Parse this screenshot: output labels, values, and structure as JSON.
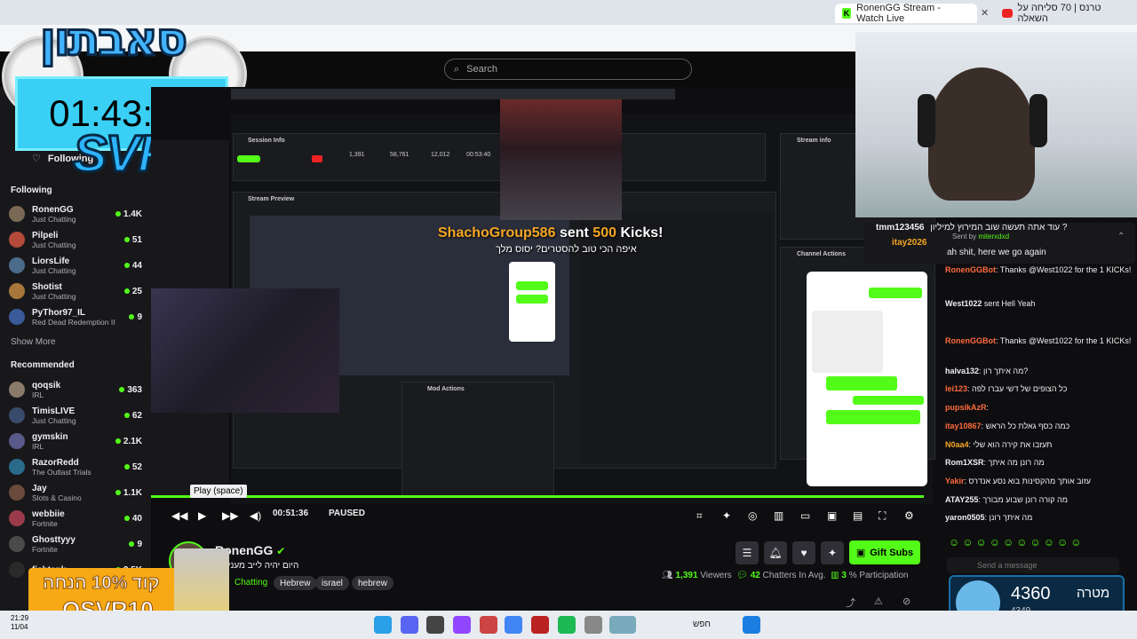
{
  "browser": {
    "tabs": [
      {
        "label": "RonenGG Stream - Watch Live"
      },
      {
        "label": "טרנס | 70 סליחה על השאלה"
      }
    ]
  },
  "header": {
    "search_placeholder": "Search"
  },
  "overlay": {
    "timer": "01:43:25",
    "svr": "SVR",
    "logo": "סאבתון"
  },
  "sidebar": {
    "following_title": "Following",
    "following_top": "Following",
    "following": [
      {
        "name": "RonenGG",
        "game": "Just Chatting",
        "viewers": "1.4K",
        "color": "#7a6a55"
      },
      {
        "name": "Pilpeli",
        "game": "Just Chatting",
        "viewers": "51",
        "color": "#b34a3a"
      },
      {
        "name": "LiorsLife",
        "game": "Just Chatting",
        "viewers": "44",
        "color": "#4b6b8a"
      },
      {
        "name": "Shotist",
        "game": "Just Chatting",
        "viewers": "25",
        "color": "#a8763a"
      },
      {
        "name": "PyThor97_IL",
        "game": "Red Dead Redemption II",
        "viewers": "9",
        "color": "#3a5a9a"
      }
    ],
    "show_more": "Show More",
    "recommended_title": "Recommended",
    "recommended": [
      {
        "name": "qoqsik",
        "game": "IRL",
        "viewers": "363",
        "color": "#8a7a6a"
      },
      {
        "name": "TimisLIVE",
        "game": "Just Chatting",
        "viewers": "62",
        "color": "#3a4a6a"
      },
      {
        "name": "gymskin",
        "game": "IRL",
        "viewers": "2.1K",
        "color": "#5a5a8a"
      },
      {
        "name": "RazorRedd",
        "game": "The Outlast Trials",
        "viewers": "52",
        "color": "#2a6a8a"
      },
      {
        "name": "Jay",
        "game": "Slots & Casino",
        "viewers": "1.1K",
        "color": "#6a4a3a"
      },
      {
        "name": "webbiie",
        "game": "Fortnite",
        "viewers": "40",
        "color": "#9a3a4a"
      },
      {
        "name": "Ghosttyyy",
        "game": "Fortnite",
        "viewers": "9",
        "color": "#4a4a4a"
      },
      {
        "name": "fishtank",
        "game": "",
        "viewers": "2.5K",
        "color": "#2a2a2a"
      }
    ]
  },
  "video": {
    "alert_user": "ShachoGroup586",
    "alert_sent": "sent",
    "alert_amount": "500",
    "alert_kicks": "Kicks!",
    "alert_sub": "איפה הכי טוב להסטרים? יסוס מלך",
    "tooltip": "Play (space)",
    "time": "00:51:36",
    "status": "PAUSED",
    "inner_labels": {
      "session_info": "Session Info",
      "stream_preview": "Stream Preview",
      "stream_info": "Stream info",
      "channel_actions": "Channel Actions",
      "mod_actions": "Mod Actions",
      "stats": [
        "STREAMING",
        "Partner Income",
        "OFF",
        "Multistream",
        "1,391",
        "Viewers",
        "58,761",
        "Followers",
        "12,012",
        "Sub Counts",
        "00:53:40",
        "Time Live"
      ]
    }
  },
  "stream": {
    "name": "RonenGG",
    "title": "היום יהיה לייב מעניין מ",
    "tags": [
      "Chatting",
      "Hebrew",
      "israel",
      "hebrew"
    ],
    "gift_subs": "Gift Subs",
    "viewers": "1,391",
    "viewers_label": "Viewers",
    "chatters": "42",
    "chatters_label": "Chatters In Avg.",
    "participation": "3",
    "participation_label": "% Participation"
  },
  "chat": {
    "pinned_top": "עוד אתה תעשה שוב המירוץ למיליון ?",
    "pinned_user": "tmm123456",
    "pinned_by": "Sent by",
    "pinned_by_user": "miterxdxd",
    "second_user": "itay2026",
    "pinned_msg": "ah shit, here we go again",
    "messages": [
      {
        "user": "RonenGGBot",
        "text": ": Thanks @West1022 for the 1 KICKs!",
        "color": "#ff6a3d"
      },
      {
        "user": "West1022",
        "text": " sent Hell Yeah",
        "color": "#efeff1"
      },
      {
        "user": "RonenGGBot",
        "text": ": Thanks @West1022 for the 1 KICKs!",
        "color": "#ff6a3d"
      },
      {
        "user": "halva132",
        "text": ": מה איתך רון?",
        "color": "#efeff1"
      },
      {
        "user": "lei123",
        "text": ": כל הצופים של דשי עברו לפה",
        "color": "#ff6a3d"
      },
      {
        "user": "pupsikAzR",
        "text": ":",
        "color": "#ff6a3d"
      },
      {
        "user": "itay10867",
        "text": ": כמה כסף גאלת כל הראש",
        "color": "#ff6a3d"
      },
      {
        "user": "N0aa4",
        "text": ": תעזבו את קירה הוא שלי",
        "color": "#f6a623"
      },
      {
        "user": "Rom1XSR",
        "text": ": מה רונן מה איתך",
        "color": "#efeff1"
      },
      {
        "user": "Yakir",
        "text": ": עזוב אותך מהקסינות בוא נסע אנדרס",
        "color": "#ff6a3d"
      },
      {
        "user": "ATAY255",
        "text": ": מה קורה רונן שבוע מבורך",
        "color": "#efeff1"
      },
      {
        "user": "yaron0505",
        "text": ": מה איתך רונן",
        "color": "#efeff1"
      }
    ],
    "input_placeholder": "Send a message",
    "goal_value": "4360",
    "goal_label": "מטרה",
    "goal_sub": "4349"
  },
  "ad": {
    "line1": "קוד 10% הנחה",
    "line2": "OSVR10"
  },
  "taskbar": {
    "time": "21:29",
    "date": "11/04",
    "search": "חפש"
  }
}
